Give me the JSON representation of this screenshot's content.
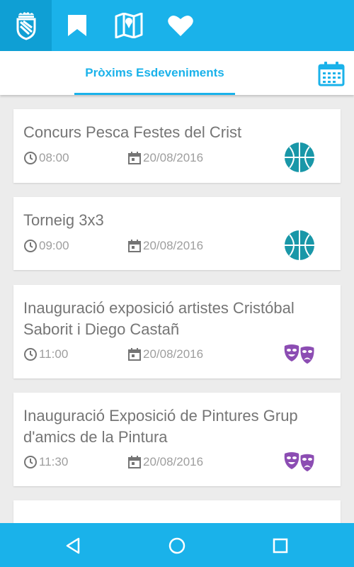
{
  "header": {
    "icons": [
      "town-crest-icon",
      "bookmark-icon",
      "map-icon",
      "heart-icon"
    ]
  },
  "tabs": {
    "active_label": "Pròxims Esdeveniments",
    "calendar_icon": "calendar-icon"
  },
  "events": [
    {
      "title": "Concurs Pesca Festes del Crist",
      "time": "08:00",
      "date": "20/08/2016",
      "category": "basketball-icon"
    },
    {
      "title": "Torneig 3x3",
      "time": "09:00",
      "date": "20/08/2016",
      "category": "basketball-icon"
    },
    {
      "title": "Inauguració exposició artistes Cristóbal Saborit i Diego Castañ",
      "time": "11:00",
      "date": "20/08/2016",
      "category": "theater-masks-icon"
    },
    {
      "title": "Inauguració Exposició de Pintures Grup d'amics de la Pintura",
      "time": "11:30",
      "date": "20/08/2016",
      "category": "theater-masks-icon"
    }
  ],
  "colors": {
    "accent": "#1ab2ea",
    "accent_dark": "#0f9fd4",
    "basketball": "#1997a8",
    "theater": "#8c4db3",
    "text": "#757575",
    "meta": "#9e9e9e",
    "background": "#ececec"
  },
  "navigation": {
    "icons": [
      "back-icon",
      "home-icon",
      "recents-icon"
    ]
  }
}
